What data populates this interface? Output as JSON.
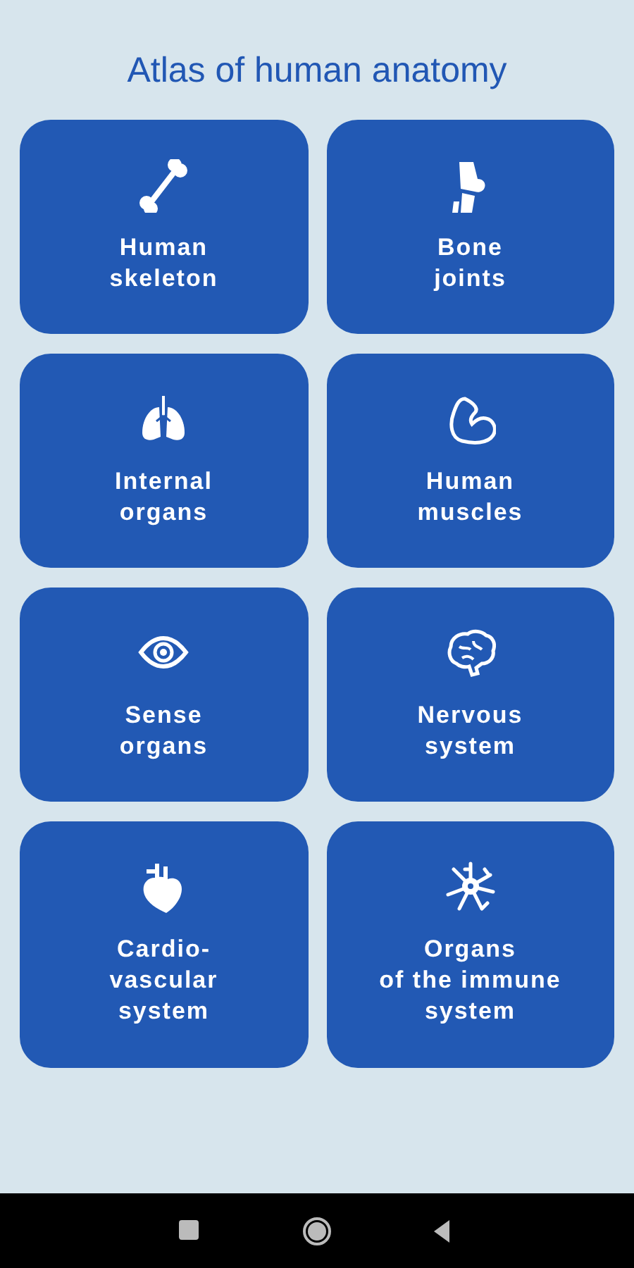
{
  "title": "Atlas of human anatomy",
  "tiles": [
    {
      "kind": "bone",
      "label": "Human\nskeleton"
    },
    {
      "kind": "joint",
      "label": "Bone\njoints"
    },
    {
      "kind": "lungs",
      "label": "Internal\norgans"
    },
    {
      "kind": "muscle",
      "label": "Human\nmuscles"
    },
    {
      "kind": "eye",
      "label": "Sense\norgans"
    },
    {
      "kind": "brain",
      "label": "Nervous\nsystem"
    },
    {
      "kind": "heart",
      "label": "Cardio-\nvascular\nsystem"
    },
    {
      "kind": "cell",
      "label": "Organs\nof the immune\nsystem"
    }
  ],
  "nav_bar": [
    {
      "kind": "recents"
    },
    {
      "kind": "home"
    },
    {
      "kind": "back"
    }
  ]
}
